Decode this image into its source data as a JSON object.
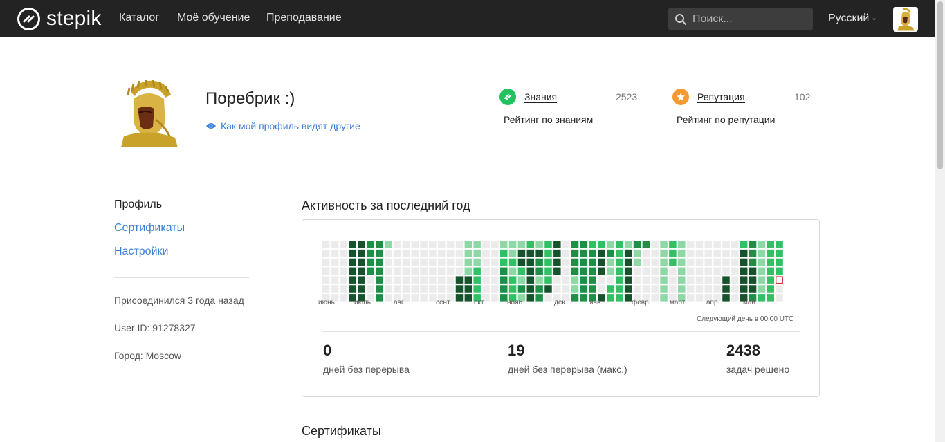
{
  "header": {
    "logo_text": "stepik",
    "nav": [
      "Каталог",
      "Моё обучение",
      "Преподавание"
    ],
    "search_placeholder": "Поиск...",
    "language": "Русский"
  },
  "profile": {
    "name": "Поребрик :)",
    "view_link": "Как мой профиль видят другие",
    "knowledge": {
      "label": "Знания",
      "value": "2523",
      "caption": "Рейтинг по знаниям"
    },
    "reputation": {
      "label": "Репутация",
      "value": "102",
      "caption": "Рейтинг по репутации"
    }
  },
  "sidebar": {
    "links": [
      "Профиль",
      "Сертификаты",
      "Настройки"
    ],
    "joined": "Присоединился 3 года назад",
    "user_id": "User ID: 91278327",
    "city": "Город: Moscow"
  },
  "activity": {
    "title": "Активность за последний год",
    "months": [
      "июнь",
      "июль",
      "авг.",
      "сент.",
      "окт.",
      "нояб.",
      "дек.",
      "янв.",
      "февр.",
      "март",
      "апр.",
      "май"
    ],
    "next_day": "Следующий день в 00:00 UTC",
    "grid": [
      "0000000",
      "0000000",
      "0000000",
      "4444444",
      "4444444",
      "3333000",
      "3333333",
      "1000000",
      "0000000",
      "0000000",
      "0000000",
      "0000000",
      "0000000",
      "0000000",
      "0000000",
      "0000444",
      "1111444",
      "1112222",
      "0000000",
      "0000000",
      "1223333",
      "1121222",
      "1442131",
      "2444444",
      "1433133",
      "2222240",
      "4444000",
      "0000000",
      "3333113",
      "3333333",
      "2333333",
      "2444004",
      "1311022",
      "2222222",
      "1444444",
      "3110000",
      "3000000",
      "0000000",
      "1111111",
      "2220000",
      "1111111",
      "0000000",
      "0000000",
      "0000000",
      "0000000",
      "0000444",
      "0000000",
      "2444444",
      "3334443",
      "1111112",
      "2222222",
      "2222000"
    ],
    "colors": {
      "0": "#ebebeb",
      "1": "#8ed8a6",
      "2": "#30c165",
      "3": "#1d8f47",
      "4": "#16522c",
      "today_border": "#c62828"
    },
    "current_streak": "0",
    "current_streak_caption": "дней без перерыва",
    "max_streak": "19",
    "max_streak_caption": "дней без перерыва (макс.)",
    "solved": "2438",
    "solved_caption": "задач решено"
  },
  "certificates": {
    "title": "Сертификаты"
  }
}
